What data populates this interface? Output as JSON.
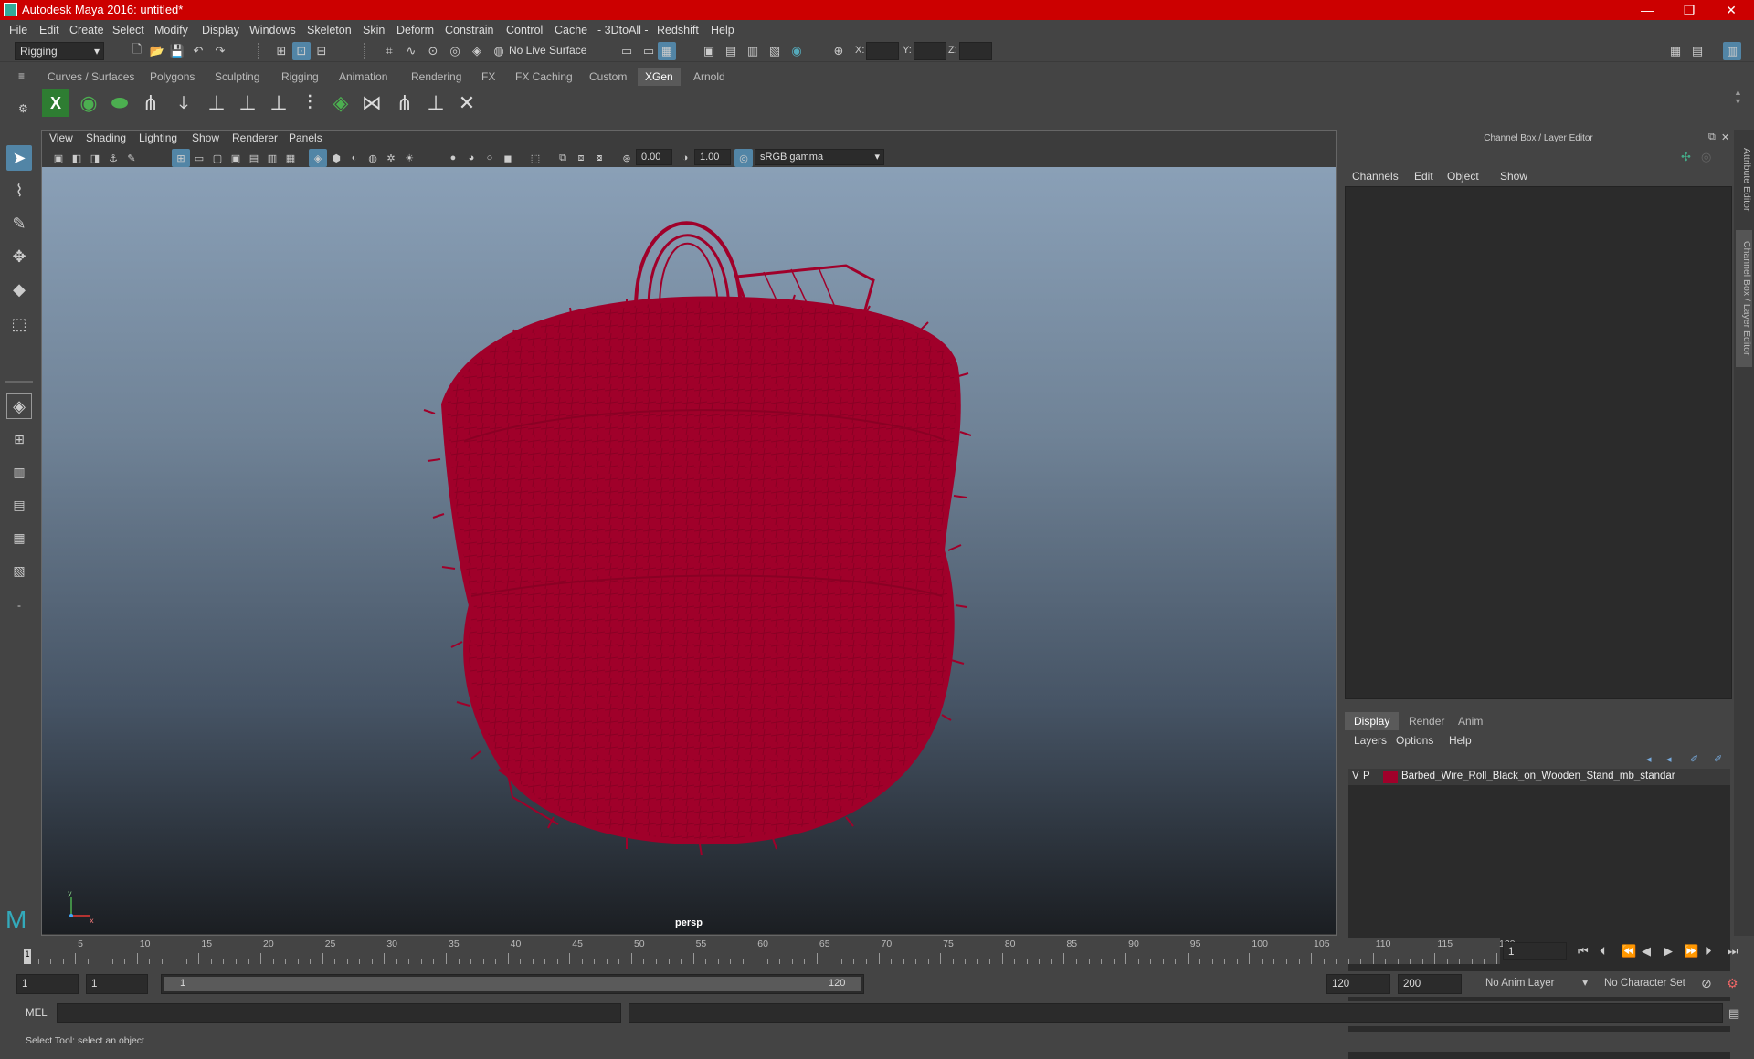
{
  "window": {
    "title": "Autodesk Maya 2016: untitled*",
    "minimize": "—",
    "restore": "❐",
    "close": "✕"
  },
  "menubar": [
    "File",
    "Edit",
    "Create",
    "Select",
    "Modify",
    "Display",
    "Windows",
    "Skeleton",
    "Skin",
    "Deform",
    "Constrain",
    "Control",
    "Cache",
    "- 3DtoAll -",
    "Redshift",
    "Help"
  ],
  "status": {
    "mode": "Rigging",
    "live_surface": "No Live Surface",
    "x_label": "X:",
    "y_label": "Y:",
    "z_label": "Z:"
  },
  "shelf_tabs": [
    "Curves / Surfaces",
    "Polygons",
    "Sculpting",
    "Rigging",
    "Animation",
    "Rendering",
    "FX",
    "FX Caching",
    "Custom",
    "XGen",
    "Arnold"
  ],
  "shelf_active": "XGen",
  "viewport": {
    "menu": [
      "View",
      "Shading",
      "Lighting",
      "Show",
      "Renderer",
      "Panels"
    ],
    "exposure": "0.00",
    "gamma": "1.00",
    "colorspace": "sRGB gamma",
    "camera": "persp"
  },
  "channelbox": {
    "title": "Channel Box / Layer Editor",
    "menu": [
      "Channels",
      "Edit",
      "Object",
      "Show"
    ]
  },
  "layers": {
    "tabs": [
      "Display",
      "Render",
      "Anim"
    ],
    "active_tab": "Display",
    "menu": [
      "Layers",
      "Options",
      "Help"
    ],
    "row": {
      "v": "V",
      "p": "P",
      "name": "Barbed_Wire_Roll_Black_on_Wooden_Stand_mb_standar",
      "color": "#a0002a"
    }
  },
  "side_tabs": [
    "Attribute Editor",
    "Channel Box / Layer Editor"
  ],
  "timeline": {
    "labels": [
      "1",
      "5",
      "10",
      "15",
      "20",
      "25",
      "30",
      "35",
      "40",
      "45",
      "50",
      "55",
      "60",
      "65",
      "70",
      "75",
      "80",
      "85",
      "90",
      "95",
      "100",
      "105",
      "110",
      "115",
      "120"
    ],
    "current_frame": "1"
  },
  "range": {
    "start": "1",
    "playback_start": "1",
    "slider_start": "1",
    "slider_end": "120",
    "playback_end": "120",
    "end": "200",
    "anim_layer": "No Anim Layer",
    "character_set": "No Character Set"
  },
  "cmd": {
    "lang": "MEL"
  },
  "help": "Select Tool: select an object",
  "colors": {
    "wire": "#a0002a",
    "accent": "#5285a6",
    "titlebar": "#cc0000"
  }
}
